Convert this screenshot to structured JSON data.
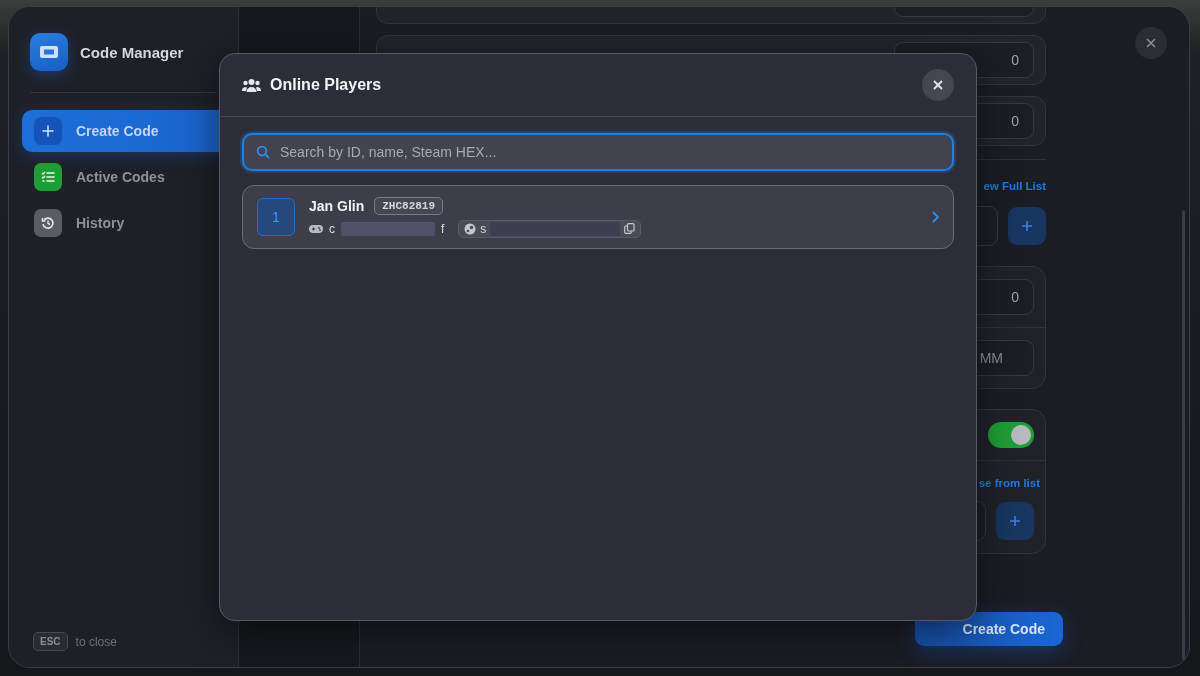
{
  "window": {
    "title": "Code Manager"
  },
  "sidebar": {
    "items": [
      {
        "label": "Create Code",
        "kind": "plus",
        "selected": true,
        "color": "#1553b8"
      },
      {
        "label": "Active Codes",
        "kind": "list",
        "selected": false,
        "color": "#1f9e35"
      },
      {
        "label": "History",
        "kind": "history",
        "selected": false,
        "color": "#5a5c64"
      }
    ]
  },
  "footer": {
    "key": "ESC",
    "hint": "to close"
  },
  "form": {
    "money_rows": [
      {
        "value": "0"
      },
      {
        "value": "0"
      }
    ],
    "items": {
      "link": "ew Full List"
    },
    "limits": {
      "max_uses": "0",
      "expiry_placeholder": "MM"
    },
    "privacy": {
      "on": true,
      "link": "se from list"
    },
    "submit": "Create Code"
  },
  "modal": {
    "title": "Online Players",
    "search": {
      "placeholder": "Search by ID, name, Steam HEX..."
    },
    "players": [
      {
        "index": "1",
        "name": "Jan Glin",
        "code": "ZHC82819",
        "id_start": "c",
        "id_end": "f",
        "steam_start": "s"
      }
    ]
  }
}
